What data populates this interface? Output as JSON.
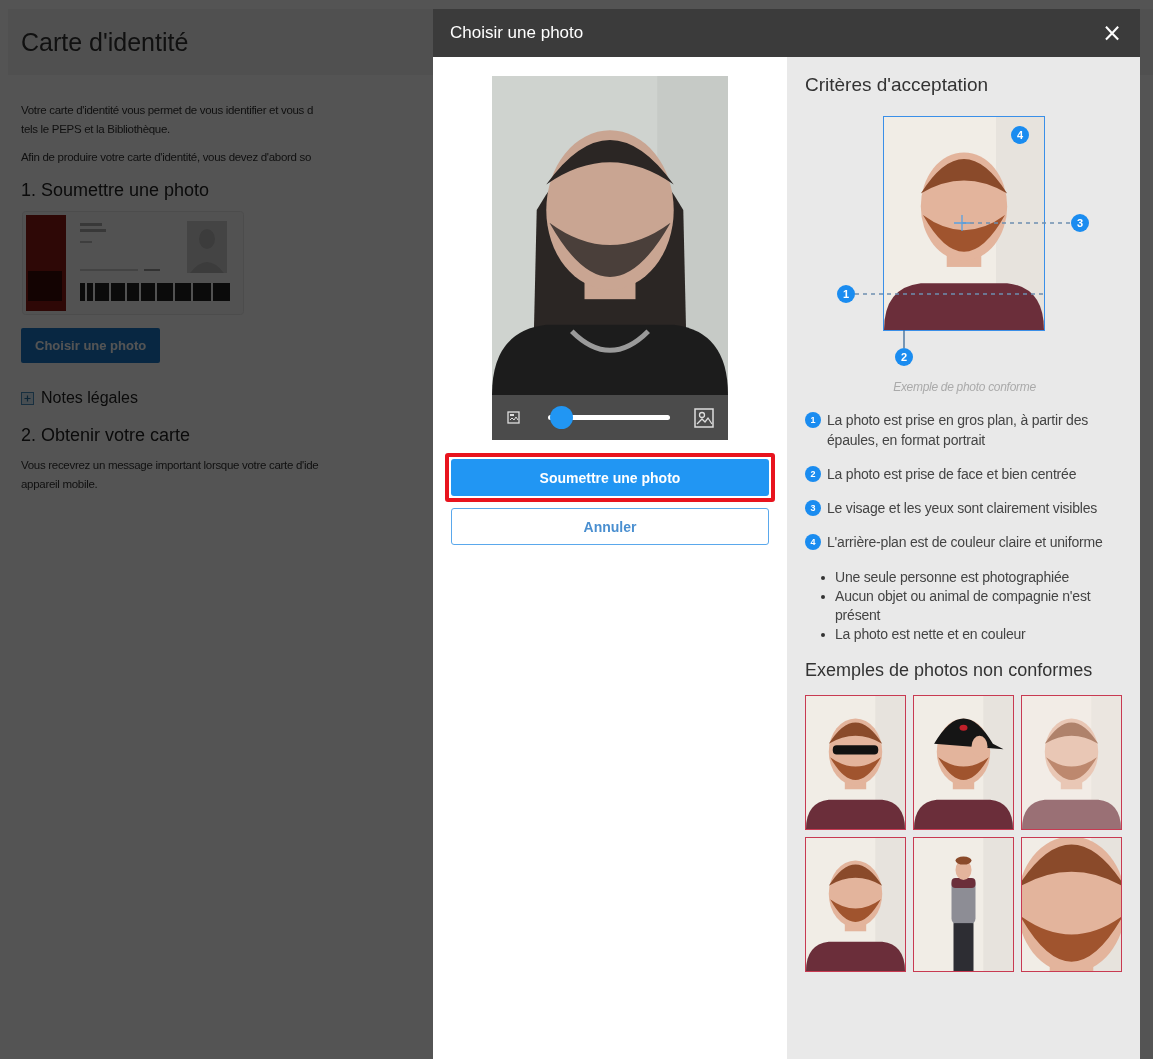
{
  "background_page": {
    "title": "Carte d'identité",
    "intro_lines": [
      "Votre carte d'identité vous permet de vous identifier et vous d",
      "tels le PEPS et la Bibliothèque."
    ],
    "note_line": "Afin de produire votre carte d'identité, vous devez d'abord so",
    "section_1": {
      "heading": "1. Soumettre une photo",
      "button": "Choisir une photo",
      "expander": {
        "label": "Notes légales",
        "expanded": false
      }
    },
    "section_2": {
      "heading": "2. Obtenir votre carte",
      "lines": [
        "Vous recevrez un message important lorsque votre carte d'ide",
        "appareil mobile."
      ]
    }
  },
  "dialog": {
    "title": "Choisir une photo",
    "close": "×",
    "preview": {
      "kind": "picture",
      "zoom": {
        "level": 0.05
      }
    },
    "buttons": [
      {
        "label": "Soumettre une photo",
        "kind": "primary",
        "highlighted": true
      },
      {
        "label": "Annuler",
        "kind": "secondary",
        "highlighted": false
      }
    ],
    "criteria": {
      "title": "Critères d'acceptation",
      "example": {
        "kind": "picture",
        "markers": [
          "1",
          "2",
          "3",
          "4"
        ],
        "caption": "Exemple de photo conforme"
      },
      "items": [
        {
          "number": "1",
          "text": "La photo est prise en gros plan, à partir des épaules, en format portrait"
        },
        {
          "number": "2",
          "text": "La photo est prise de face et bien centrée"
        },
        {
          "number": "3",
          "text": "Le visage et les yeux sont clairement visibles"
        },
        {
          "number": "4",
          "text": "L'arrière-plan est de couleur claire et uniforme"
        }
      ],
      "bullets": [
        "Une seule personne est photographiée",
        "Aucun objet ou animal de compagnie n'est présent",
        "La photo est nette et en couleur"
      ],
      "non_compliant": {
        "title": "Exemples de photos non conformes"
      }
    }
  }
}
